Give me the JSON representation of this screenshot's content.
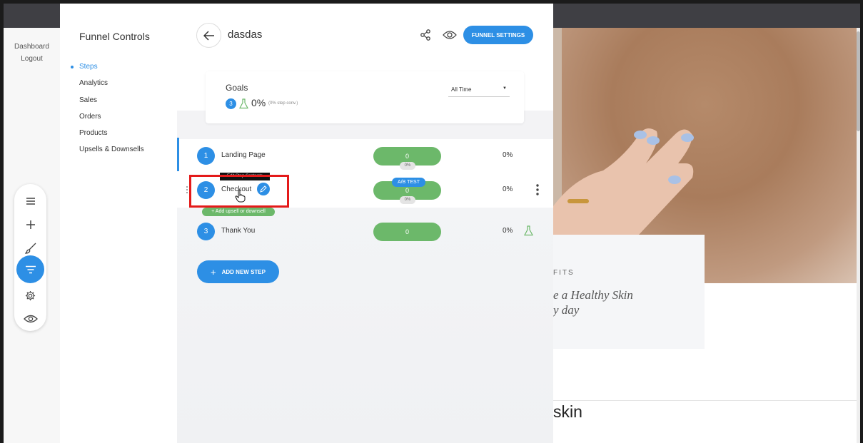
{
  "side_nav": {
    "dashboard": "Dashboard",
    "logout": "Logout"
  },
  "toolbar": {
    "items": [
      {
        "name": "menu-icon"
      },
      {
        "name": "plus-icon"
      },
      {
        "name": "brush-icon"
      },
      {
        "name": "funnel-filter-icon",
        "active": true
      },
      {
        "name": "gear-icon"
      },
      {
        "name": "eye-icon"
      }
    ],
    "accent": "#2d8fe5"
  },
  "funnel_controls": {
    "title": "Funnel Controls",
    "menu": [
      "Steps",
      "Analytics",
      "Sales",
      "Orders",
      "Products",
      "Upsells & Downsells"
    ],
    "active": "Steps"
  },
  "header": {
    "funnel_name": "dasdas",
    "settings_button": "FUNNEL SETTINGS"
  },
  "goals": {
    "label": "Goals",
    "count": "3",
    "percent": "0%",
    "sub": "(0% step conv.)",
    "range": "All Time"
  },
  "steps": [
    {
      "num": "1",
      "name": "Landing Page",
      "value": "0",
      "badge": "0%",
      "rate": "0%"
    },
    {
      "num": "2",
      "name": "Checkout",
      "value": "0",
      "badge": "0%",
      "rate": "0%",
      "ab_label": "A/B TEST",
      "tooltip": "Edit Step Contents"
    },
    {
      "num": "3",
      "name": "Thank You",
      "value": "0",
      "rate": "0%"
    }
  ],
  "add_upsell": "+ Add upsell or downsell",
  "add_step": "ADD NEW STEP",
  "preview": {
    "eyebrow": "FITS",
    "headline_1": "e a Healthy Skin",
    "headline_2": "y day",
    "footer_word": "skin"
  },
  "colors": {
    "primary": "#2d8fe5",
    "success": "#6cb86a",
    "highlight": "#e41a1a"
  }
}
